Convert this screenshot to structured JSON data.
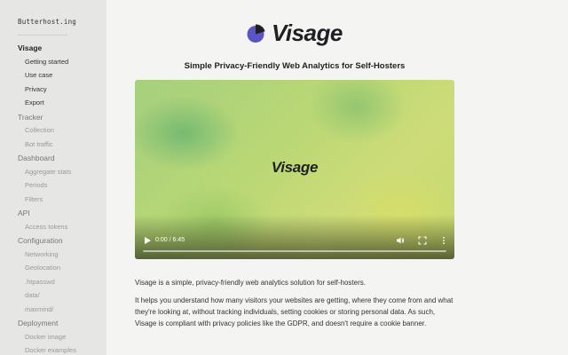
{
  "sidebar": {
    "brand": "Butterhost.ing",
    "sections": [
      {
        "label": "Visage",
        "active": true,
        "items": [
          {
            "label": "Getting started",
            "active": true
          },
          {
            "label": "Use case",
            "active": true
          },
          {
            "label": "Privacy",
            "active": true
          },
          {
            "label": "Export",
            "active": true
          }
        ]
      },
      {
        "label": "Tracker",
        "items": [
          {
            "label": "Collection"
          },
          {
            "label": "Bot traffic"
          }
        ]
      },
      {
        "label": "Dashboard",
        "items": [
          {
            "label": "Aggregate stats"
          },
          {
            "label": "Periods"
          },
          {
            "label": "Filters"
          }
        ]
      },
      {
        "label": "API",
        "items": [
          {
            "label": "Access tokens"
          }
        ]
      },
      {
        "label": "Configuration",
        "items": [
          {
            "label": "Networking"
          },
          {
            "label": "Geolocation"
          },
          {
            "label": ".htpasswd"
          },
          {
            "label": "data/"
          },
          {
            "label": "maxmind/"
          }
        ]
      },
      {
        "label": "Deployment",
        "items": [
          {
            "label": "Docker image"
          },
          {
            "label": "Docker examples"
          }
        ]
      }
    ]
  },
  "main": {
    "logo_text": "Visage",
    "subtitle": "Simple Privacy-Friendly Web Analytics for Self-Hosters",
    "video": {
      "title": "Visage",
      "time": "0:00 / 6:45",
      "progress": 0
    },
    "paragraphs": [
      "Visage is a simple, privacy-friendly web analytics solution for self-hosters.",
      "It helps you understand how many visitors your websites are getting, where they come from and what they're looking at, without tracking individuals, setting cookies or storing personal data. As such, Visage is compliant with privacy policies like the GDPR, and doesn't require a cookie banner."
    ]
  },
  "colors": {
    "logo_purple": "#5b54c6",
    "logo_dark": "#1f1f24",
    "sidebar_bg": "#e6e6e4",
    "page_bg": "#f4f4f2"
  }
}
